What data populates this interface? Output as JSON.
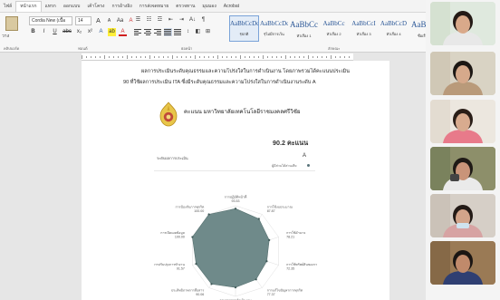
{
  "menu": {
    "tabs": [
      "ไฟล์",
      "หน้าแรก",
      "แทรก",
      "ออกแบบ",
      "เค้าโครง",
      "การอ้างอิง",
      "การส่งจดหมาย",
      "ตรวจทาน",
      "มุมมอง",
      "Acrobat"
    ],
    "active_tab": "หน้าแรก"
  },
  "ribbon": {
    "clipboard_label": "วาง",
    "font_name": "Cordia New (เนื้อ",
    "font_size": "14",
    "bold": "B",
    "italic": "I",
    "underline": "U",
    "strike": "abc",
    "subscript": "x₂",
    "superscript": "x²",
    "text_effects": "A",
    "highlight": "ab",
    "font_color": "A",
    "grow_font": "A",
    "shrink_font": "A",
    "change_case": "Aa",
    "clear_format": "A",
    "sort": "A↓",
    "show_marks": "¶",
    "groups": [
      "คลิปบอร์ด",
      "ฟอนต์",
      "ย่อหน้า",
      "ลักษณะ"
    ],
    "styles": [
      {
        "sample": "AaBbCcDc",
        "name": "¶ปกติ",
        "active": true
      },
      {
        "sample": "AaBbCcDc",
        "name": "¶ไม่มีการเว้น",
        "active": false
      },
      {
        "sample": "AaBbCc",
        "name": "หัวเรื่อง 1",
        "active": false,
        "big": true
      },
      {
        "sample": "AaBbCc",
        "name": "หัวเรื่อง 2",
        "active": false
      },
      {
        "sample": "AaBbCcI",
        "name": "หัวเรื่อง 3",
        "active": false
      },
      {
        "sample": "AaBbCcD",
        "name": "หัวเรื่อง 4",
        "active": false
      },
      {
        "sample": "AaBbC",
        "name": "ชื่อเรื่อง",
        "active": false,
        "big": true
      },
      {
        "sample": "AaBbCcD",
        "name": "ชื่อเรื่องรอง",
        "active": false
      }
    ]
  },
  "document": {
    "line1": "ผลการประเมินระดับคุณธรรมและความโปร่งใสในการดำเนินงาน โดยภาพรวมได้คะแนนประเมิน",
    "line2": "ที่ใช้ผลการประเมิน ITA ซึ่งมีระดับคุณธรรมและความโปร่งใสในการดำเนินงานระดับ A",
    "line2_prefix": "90",
    "university": "คะแนน มหาวิทยาลัยเทคโนโลยีราชมงคลศรีวิชัย",
    "score": "90.2 คะแนน",
    "score_label": "ระดับผลการประเมิน",
    "grade": "A",
    "grade_note": "ผู้มีส่วนได้ส่วนเสีย",
    "colors": {
      "radar_fill": "#6f8a8a",
      "radar_stroke": "#55706f"
    }
  },
  "chart_data": {
    "type": "radar",
    "categories": [
      "การปฏิบัติหน้าที่",
      "การใช้งบประมาณ",
      "การใช้อำนาจ",
      "การใช้ทรัพย์สินของราชการ",
      "การแก้ไขปัญหาการทุจริต",
      "คุณภาพการดำเนินงาน",
      "ประสิทธิภาพการสื่อสาร",
      "การปรับปรุงการทำงาน",
      "การเปิดเผยข้อมูล",
      "การป้องกันการทุจริต"
    ],
    "values": [
      93.53,
      87.87,
      78.21,
      72.35,
      77.37,
      80.27,
      90.06,
      91.57,
      100.0,
      100.0
    ],
    "value_labels": [
      "93.53",
      "87.87",
      "78.21",
      "72.35",
      "77.37",
      "80.27",
      "90.06",
      "91.57",
      "100.00",
      "100.00"
    ],
    "rlim": [
      0,
      100
    ]
  },
  "participants": [
    {
      "label": "participant-1"
    },
    {
      "label": "participant-2"
    },
    {
      "label": "participant-3"
    },
    {
      "label": "participant-4"
    },
    {
      "label": "participant-5"
    },
    {
      "label": "participant-6"
    }
  ]
}
